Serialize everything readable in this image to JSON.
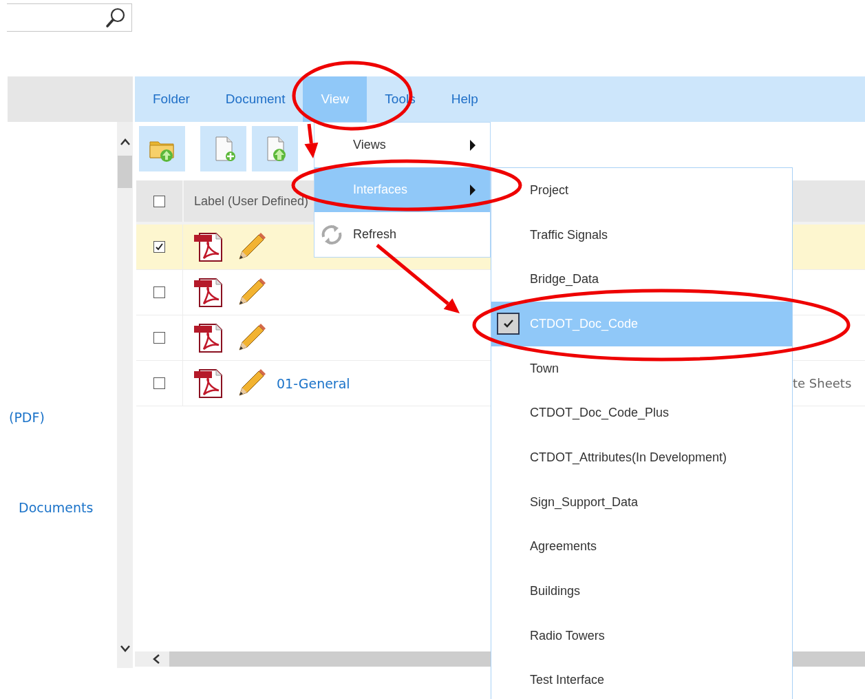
{
  "sidebar": {
    "links": [
      "(PDF)",
      "Documents"
    ]
  },
  "ribbon": {
    "tabs": [
      {
        "label": "Folder",
        "selected": false
      },
      {
        "label": "Document",
        "selected": false
      },
      {
        "label": "View",
        "selected": true
      },
      {
        "label": "Tools",
        "selected": false
      },
      {
        "label": "Help",
        "selected": false
      }
    ]
  },
  "toolbar": {
    "buttons": [
      {
        "kind": "upload-folder"
      },
      {
        "kind": "add-document"
      },
      {
        "kind": "upload-document"
      }
    ]
  },
  "table": {
    "header_checked": false,
    "columns": [
      {
        "label": "Label (User Defined)"
      }
    ],
    "rows": [
      {
        "kind": "pdf",
        "checked": true
      },
      {
        "kind": "pdf",
        "checked": false
      },
      {
        "kind": "pdf",
        "checked": false
      },
      {
        "kind": "pdf",
        "checked": false,
        "name": "01-General",
        "column_3": "te Sheets"
      }
    ]
  },
  "view_menu": {
    "items": [
      {
        "label": "Views",
        "kind": "submenu",
        "selected": false
      },
      {
        "label": "Interfaces",
        "kind": "submenu",
        "selected": true
      },
      {
        "label": "Refresh",
        "kind": "refresh",
        "selected": false
      }
    ]
  },
  "interfaces_menu": {
    "items": [
      {
        "label": "Project",
        "checked": false,
        "selected": false
      },
      {
        "label": "Traffic Signals",
        "checked": false,
        "selected": false
      },
      {
        "label": "Bridge_Data",
        "checked": false,
        "selected": false
      },
      {
        "label": "CTDOT_Doc_Code",
        "checked": true,
        "selected": true
      },
      {
        "label": "Town",
        "checked": false,
        "selected": false
      },
      {
        "label": "CTDOT_Doc_Code_Plus",
        "checked": false,
        "selected": false
      },
      {
        "label": "CTDOT_Attributes(In Development)",
        "checked": false,
        "selected": false
      },
      {
        "label": "Sign_Support_Data",
        "checked": false,
        "selected": false
      },
      {
        "label": "Agreements",
        "checked": false,
        "selected": false
      },
      {
        "label": "Buildings",
        "checked": false,
        "selected": false
      },
      {
        "label": "Radio Towers",
        "checked": false,
        "selected": false
      },
      {
        "label": "Test Interface",
        "checked": false,
        "selected": false
      }
    ]
  },
  "annotations": [
    {
      "kind": "ellipse"
    },
    {
      "kind": "arrow"
    },
    {
      "kind": "ellipse"
    },
    {
      "kind": "arrow"
    },
    {
      "kind": "ellipse"
    }
  ]
}
